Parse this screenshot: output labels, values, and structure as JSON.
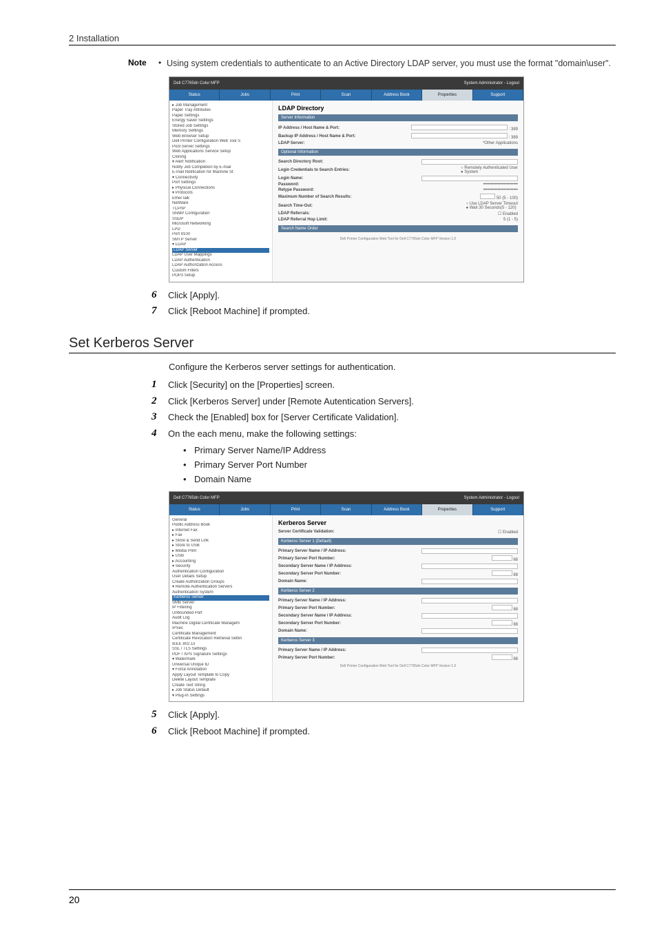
{
  "header": {
    "section": "2 Installation"
  },
  "note": {
    "label": "Note",
    "text": "Using system credentials to authenticate to an Active Directory LDAP server, you must use the format \"domain\\user\"."
  },
  "screenshot1": {
    "topbar_title": "Dell C7765dn Color MFP",
    "topbar_right": "System Administrator - Logout",
    "tabs": [
      "Status",
      "Jobs",
      "Print",
      "Scan",
      "Address Book",
      "Properties",
      "Support"
    ],
    "active_tab": "Properties",
    "sidebar": [
      "▸ Job Management",
      "  Paper Tray Attributes",
      "  Paper Settings",
      "  Energy Saver Settings",
      "  Stored Job Settings",
      "  Memory Settings",
      "  Web Browser Setup",
      "  Dell Printer Configuration Web Tool S",
      "  Pool Server Settings",
      "  Web Applications Service Setup",
      "  Cloning",
      "▾ Alert Notification",
      "  Notify Job Completion by E-mail",
      "  E-mail Notification for Machine St",
      "▾ Connectivity",
      "  Port Settings",
      "▸ Physical Connections",
      "▾ Protocols",
      "  EtherTalk",
      "  NetWare",
      "  TCP/IP",
      "  SNMP Configuration",
      "  SSDP",
      "  Microsoft Networking",
      "  LPD",
      "  Port 9100",
      "  SMTP Server",
      "▾ LDAP",
      "  LDAP Server",
      "  LDAP User Mappings",
      "  LDAP Authentication",
      "  LDAP Authorization Access",
      "  Custom Filters",
      "  POP3 Setup"
    ],
    "sidebar_highlight": "LDAP Server",
    "main_title": "LDAP Directory",
    "bars": {
      "server_info": "Server Information",
      "optional_info": "Optional Information",
      "search_order": "Search Name Order"
    },
    "rows": {
      "ip_host": {
        "label": "IP Address / Host Name & Port:",
        "port": "389"
      },
      "backup": {
        "label": "Backup IP Address / Host Name & Port:",
        "port": "389"
      },
      "ldap_server": {
        "label": "LDAP Server:",
        "value": "*Other Applications"
      },
      "search_root": {
        "label": "Search Directory Root:"
      },
      "login_cred": {
        "label": "Login Credentials to Search Entries:",
        "opt1": "Remotely Authenticated User",
        "opt2": "System"
      },
      "login_name": {
        "label": "Login Name:"
      },
      "password": {
        "label": "Password:",
        "masked": "••••••••••••••••••••••••"
      },
      "retype": {
        "label": "Retype Password:",
        "masked": "••••••••••••••••••••••••"
      },
      "max_results": {
        "label": "Maximum Number of Search Results:",
        "value": "50",
        "range": "(5 - 100)"
      },
      "timeout": {
        "label": "Search Time-Out:",
        "opt1": "Use LDAP Server Timeout",
        "opt2_prefix": "Wait",
        "opt2_val": "30",
        "opt2_suffix": "Seconds(5 - 120)"
      },
      "referrals": {
        "label": "LDAP Referrals:",
        "checkbox": "Enabled"
      },
      "hop_limit": {
        "label": "LDAP Referral Hop Limit:",
        "value": "5",
        "range": "(1 - 5)"
      }
    },
    "footer": "Dell Printer Configuration Web Tool for Dell C7765dn Color MFP Version 1.0"
  },
  "steps_a": {
    "s6": "Click [Apply].",
    "s7": "Click [Reboot Machine] if prompted."
  },
  "section2": {
    "title": "Set Kerberos Server",
    "intro": "Configure the Kerberos server settings for authentication.",
    "s1": "Click [Security] on the [Properties] screen.",
    "s2": "Click [Kerberos Server] under [Remote Autentication Servers].",
    "s3": "Check the [Enabled] box for [Server Certificate Validation].",
    "s4": "On the each menu, make the following settings:",
    "bullets": [
      "Primary Server Name/IP Address",
      "Primary Server Port Number",
      "Domain Name"
    ]
  },
  "screenshot2": {
    "topbar_title": "Dell C7765dn Color MFP",
    "topbar_right": "System Administrator - Logout",
    "tabs": [
      "Status",
      "Jobs",
      "Print",
      "Scan",
      "Address Book",
      "Properties",
      "Support"
    ],
    "active_tab": "Properties",
    "sidebar": [
      "  General",
      "  Public Address Book",
      "▸ Internet Fax",
      "▸ Fax",
      "▸ Store & Send Link",
      "▸ Store to USB",
      "▸ Media Print",
      "▸ USB",
      "▸ Accounting",
      "▾ Security",
      "  Authentication Configuration",
      "  User Details Setup",
      "  Create Authorization Groups",
      "▾ Remote Authentication Servers",
      "  Authentication System",
      "  Kerberos Server",
      "  SMB Server",
      "  IP Filtering",
      "  Unbounded Port",
      "  Audit Log",
      "  Machine Digital Certificate Managem",
      "  IPSec",
      "  Certificate Management",
      "  Certificate Revocation Retrieval Settin",
      "  IEEE 802.1x",
      "  SSL / TLS Settings",
      "  PDF / XPS Signature Settings",
      "▾ Watermark",
      "  Universal Unique ID",
      "▾ Force Annotation",
      "  Apply Layout Template to Copy",
      "  Delete Layout Template",
      "  Create Text String",
      "▸ Job Status Default",
      "▾ Plug-In Settings"
    ],
    "sidebar_highlight": "Kerberos Server",
    "main_title": "Kerberos Server",
    "rows": {
      "cert_valid": {
        "label": "Server Certificate Validation:",
        "checkbox": "Enabled"
      },
      "primary_name": {
        "label": "Primary Server Name / IP Address:"
      },
      "primary_port": {
        "label": "Primary Server Port Number:",
        "value": "88"
      },
      "secondary_name": {
        "label": "Secondary Server Name / IP Address:"
      },
      "secondary_port": {
        "label": "Secondary Server Port Number:",
        "value": "88"
      },
      "domain": {
        "label": "Domain Name:"
      }
    },
    "bars": {
      "k1": "Kerberos Server 1 (Default)",
      "k2": "Kerberos Server 2",
      "k3": "Kerberos Server 3"
    },
    "footer": "Dell Printer Configuration Web Tool for Dell C7765dn Color MFP Version 1.0"
  },
  "steps_b": {
    "s5": "Click [Apply].",
    "s6": "Click [Reboot Machine] if prompted."
  },
  "page_number": "20"
}
